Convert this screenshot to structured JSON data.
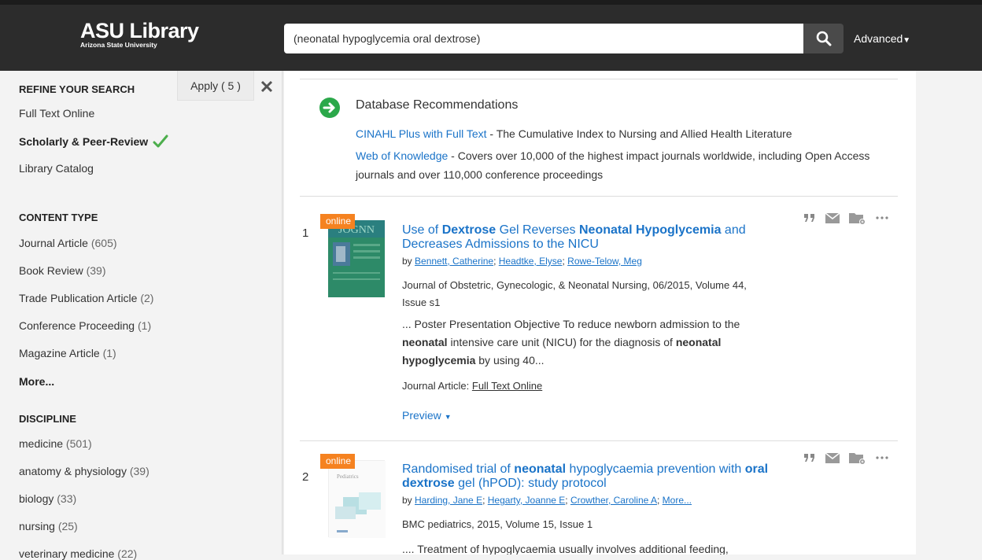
{
  "header": {
    "logo_main": "ASU Library",
    "logo_sub": "Arizona State University",
    "search_value": "(neonatal hypoglycemia oral dextrose)",
    "advanced_label": "Advanced"
  },
  "sidebar": {
    "refine_title": "REFINE YOUR SEARCH",
    "apply_label": "Apply ( 5 )",
    "refine_items": [
      {
        "label": "Full Text Online"
      },
      {
        "label": "Scholarly & Peer-Review"
      },
      {
        "label": "Library Catalog"
      }
    ],
    "content_type_title": "CONTENT TYPE",
    "content_types": [
      {
        "label": "Journal Article",
        "count": "(605)"
      },
      {
        "label": "Book Review",
        "count": "(39)"
      },
      {
        "label": "Trade Publication Article",
        "count": "(2)"
      },
      {
        "label": "Conference Proceeding",
        "count": "(1)"
      },
      {
        "label": "Magazine Article",
        "count": "(1)"
      }
    ],
    "more_label": "More...",
    "discipline_title": "DISCIPLINE",
    "disciplines": [
      {
        "label": "medicine",
        "count": "(501)"
      },
      {
        "label": "anatomy & physiology",
        "count": "(39)"
      },
      {
        "label": "biology",
        "count": "(33)"
      },
      {
        "label": "nursing",
        "count": "(25)"
      },
      {
        "label": "veterinary medicine",
        "count": "(22)"
      }
    ]
  },
  "recommendations": {
    "title": "Database Recommendations",
    "items": [
      {
        "name": "CINAHL Plus with Full Text",
        "desc": " - The Cumulative Index to Nursing and Allied Health Literature"
      },
      {
        "name": "Web of Knowledge",
        "desc": " - Covers over 10,000 of the highest impact journals worldwide, including Open Access journals and over 110,000 conference proceedings"
      }
    ]
  },
  "results": [
    {
      "num": "1",
      "badge": "online",
      "title_parts": [
        "Use of ",
        "Dextrose",
        " Gel Reverses ",
        "Neonatal Hypoglycemia",
        " and Decreases Admissions to the NICU"
      ],
      "by": "by ",
      "authors": [
        "Bennett, Catherine",
        "Headtke, Elyse",
        "Rowe-Telow, Meg"
      ],
      "meta": "Journal of Obstetric, Gynecologic, & Neonatal Nursing, 06/2015, Volume 44, Issue s1",
      "snippet_parts": [
        "... Poster Presentation Objective To reduce newborn admission to the ",
        "neonatal",
        " intensive care unit (NICU) for the diagnosis of ",
        "neonatal hypoglycemia",
        " by using 40..."
      ],
      "type_label": "Journal Article: ",
      "type_link": "Full Text Online",
      "preview_label": "Preview"
    },
    {
      "num": "2",
      "badge": "online",
      "cover_text": "Pediatrics",
      "title_parts": [
        "Randomised trial of ",
        "neonatal",
        " hypoglycaemia prevention with ",
        "oral dextrose",
        " gel (hPOD): study protocol"
      ],
      "by": "by ",
      "authors": [
        "Harding, Jane E",
        "Hegarty, Joanne E",
        "Crowther, Caroline A",
        "More..."
      ],
      "meta": "BMC pediatrics, 2015, Volume 15, Issue 1",
      "snippet": ".... Treatment of hypoglycaemia usually involves additional feeding,"
    }
  ],
  "colors": {
    "header_bg": "#2c2c2c",
    "link": "#1a73c8",
    "badge": "#f58220",
    "check": "#4cae4c",
    "rec_icon": "#2ba84a"
  }
}
